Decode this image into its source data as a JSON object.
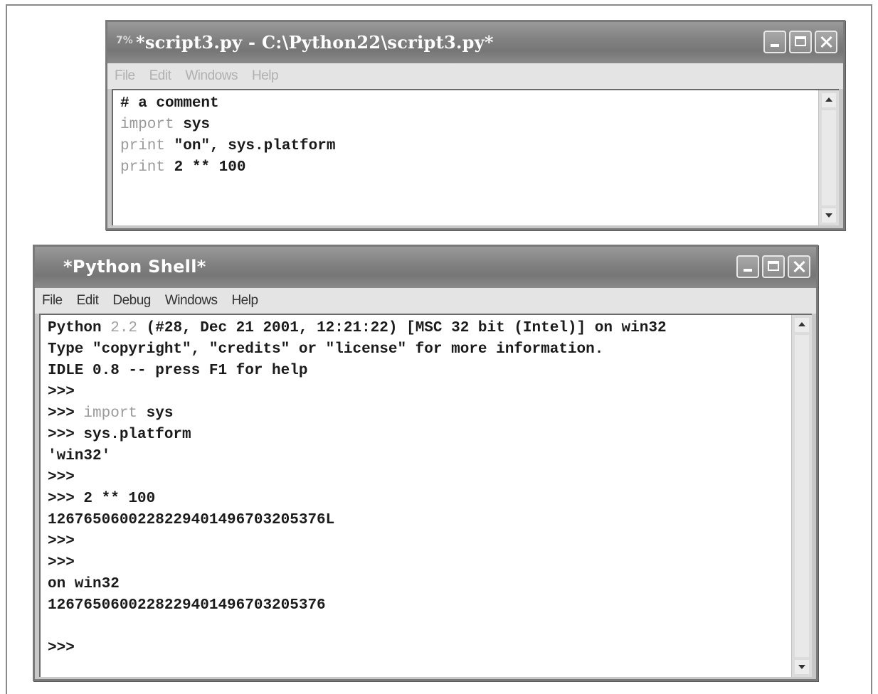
{
  "script_window": {
    "title": "*script3.py - C:\\Python22\\script3.py*",
    "menu": [
      "File",
      "Edit",
      "Windows",
      "Help"
    ],
    "code_lines": [
      {
        "parts": [
          {
            "t": "# a comment",
            "k": "plain"
          }
        ]
      },
      {
        "parts": [
          {
            "t": "import",
            "k": "kw"
          },
          {
            "t": " sys",
            "k": "plain"
          }
        ]
      },
      {
        "parts": [
          {
            "t": "print",
            "k": "kw"
          },
          {
            "t": " \"on\", sys.platform",
            "k": "plain"
          }
        ]
      },
      {
        "parts": [
          {
            "t": "print",
            "k": "kw"
          },
          {
            "t": " 2 ** 100",
            "k": "plain"
          }
        ]
      }
    ]
  },
  "shell_window": {
    "title": "*Python Shell*",
    "menu": [
      "File",
      "Edit",
      "Debug",
      "Windows",
      "Help"
    ],
    "lines": [
      {
        "parts": [
          {
            "t": "Python ",
            "k": "plain"
          },
          {
            "t": "2.2",
            "k": "num2"
          },
          {
            "t": " (#28, Dec 21 2001, 12:21:22) [MSC 32 bit (Intel)] on win32",
            "k": "plain"
          }
        ]
      },
      {
        "parts": [
          {
            "t": "Type \"copyright\", \"credits\" or \"license\" for more information.",
            "k": "plain"
          }
        ]
      },
      {
        "parts": [
          {
            "t": "IDLE 0.8 -- press F1 for help",
            "k": "plain"
          }
        ]
      },
      {
        "parts": [
          {
            "t": ">>>",
            "k": "plain"
          }
        ]
      },
      {
        "parts": [
          {
            "t": ">>> ",
            "k": "plain"
          },
          {
            "t": "import",
            "k": "kw"
          },
          {
            "t": " sys",
            "k": "plain"
          }
        ]
      },
      {
        "parts": [
          {
            "t": ">>> sys.platform",
            "k": "plain"
          }
        ]
      },
      {
        "parts": [
          {
            "t": "'win32'",
            "k": "plain"
          }
        ]
      },
      {
        "parts": [
          {
            "t": ">>>",
            "k": "plain"
          }
        ]
      },
      {
        "parts": [
          {
            "t": ">>> 2 ** 100",
            "k": "plain"
          }
        ]
      },
      {
        "parts": [
          {
            "t": "1267650600228229401496703205376L",
            "k": "plain"
          }
        ]
      },
      {
        "parts": [
          {
            "t": ">>>",
            "k": "plain"
          }
        ]
      },
      {
        "parts": [
          {
            "t": ">>>",
            "k": "plain"
          }
        ]
      },
      {
        "parts": [
          {
            "t": "on win32",
            "k": "plain"
          }
        ]
      },
      {
        "parts": [
          {
            "t": "1267650600228229401496703205376",
            "k": "plain"
          }
        ]
      },
      {
        "parts": [
          {
            "t": "",
            "k": "plain"
          }
        ]
      },
      {
        "parts": [
          {
            "t": ">>>",
            "k": "plain"
          }
        ]
      }
    ]
  }
}
